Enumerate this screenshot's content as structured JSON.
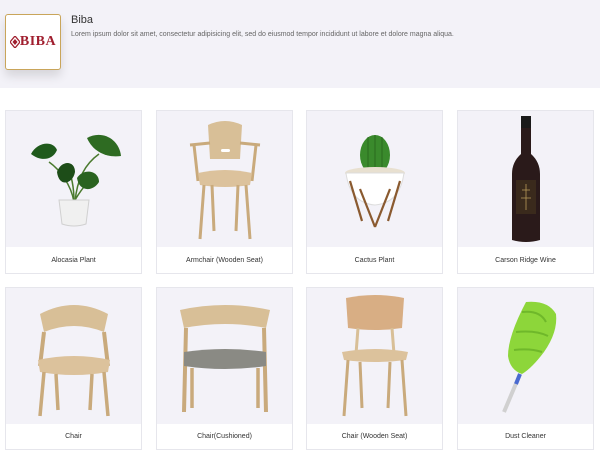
{
  "header": {
    "logo_text": "BIBA",
    "brand_name": "Biba",
    "description": "Lorem ipsum dolor sit amet, consectetur adipisicing elit, sed do eiusmod tempor incididunt ut labore et dolore magna aliqua."
  },
  "products": [
    {
      "name": "Alocasia Plant",
      "icon": "plant-icon"
    },
    {
      "name": "Armchair (Wooden Seat)",
      "icon": "armchair-icon"
    },
    {
      "name": "Cactus Plant",
      "icon": "cactus-icon"
    },
    {
      "name": "Carson Ridge Wine",
      "icon": "wine-bottle-icon"
    },
    {
      "name": "Chair",
      "icon": "chair-icon"
    },
    {
      "name": "Chair(Cushioned)",
      "icon": "cushioned-chair-icon"
    },
    {
      "name": "Chair (Wooden Seat)",
      "icon": "wooden-chair-icon"
    },
    {
      "name": "Dust Cleaner",
      "icon": "duster-icon"
    }
  ]
}
